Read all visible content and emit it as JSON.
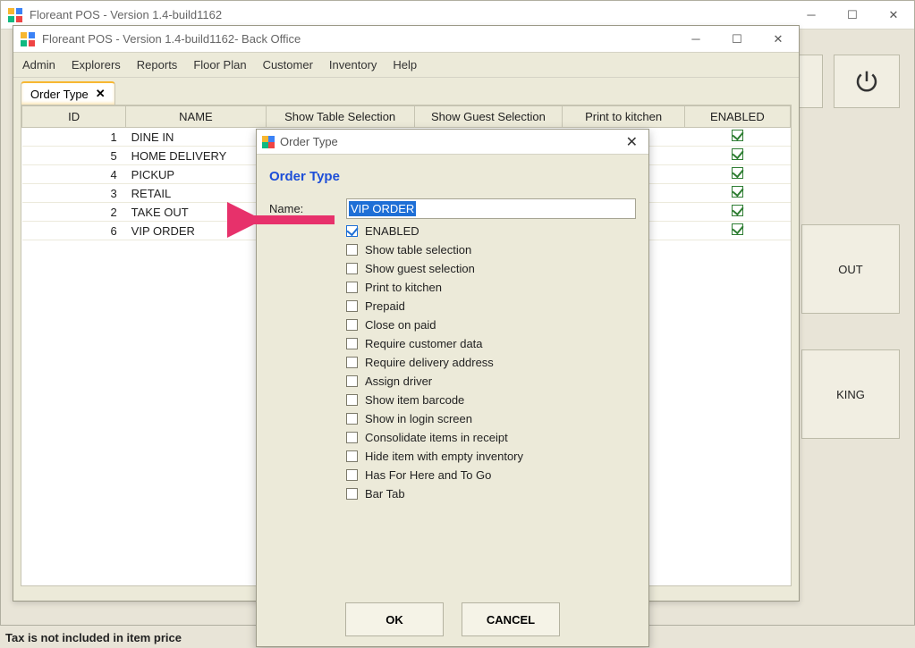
{
  "main_window": {
    "title": "Floreant POS - Version 1.4-build1162"
  },
  "back_office": {
    "title": "Floreant POS - Version 1.4-build1162- Back Office",
    "menu": [
      "Admin",
      "Explorers",
      "Reports",
      "Floor Plan",
      "Customer",
      "Inventory",
      "Help"
    ],
    "tab_label": "Order Type"
  },
  "table": {
    "headers": [
      "ID",
      "NAME",
      "Show Table Selection",
      "Show Guest Selection",
      "Print to kitchen",
      "ENABLED"
    ],
    "rows": [
      {
        "id": "1",
        "name": "DINE IN",
        "enabled": true
      },
      {
        "id": "5",
        "name": "HOME DELIVERY",
        "enabled": true
      },
      {
        "id": "4",
        "name": "PICKUP",
        "enabled": true
      },
      {
        "id": "3",
        "name": "RETAIL",
        "enabled": true
      },
      {
        "id": "2",
        "name": "TAKE OUT",
        "enabled": true
      },
      {
        "id": "6",
        "name": "VIP ORDER",
        "enabled": true
      }
    ]
  },
  "dialog": {
    "titlebar": "Order Type",
    "heading": "Order Type",
    "name_label": "Name:",
    "name_value": "VIP ORDER",
    "options": [
      {
        "label": "ENABLED",
        "checked": true
      },
      {
        "label": "Show table selection",
        "checked": false
      },
      {
        "label": "Show guest selection",
        "checked": false
      },
      {
        "label": "Print to kitchen",
        "checked": false
      },
      {
        "label": "Prepaid",
        "checked": false
      },
      {
        "label": "Close on paid",
        "checked": false
      },
      {
        "label": "Require customer data",
        "checked": false
      },
      {
        "label": "Require delivery address",
        "checked": false
      },
      {
        "label": "Assign driver",
        "checked": false
      },
      {
        "label": "Show item barcode",
        "checked": false
      },
      {
        "label": "Show in login screen",
        "checked": false
      },
      {
        "label": "Consolidate items in receipt",
        "checked": false
      },
      {
        "label": "Hide item with empty inventory",
        "checked": false
      },
      {
        "label": "Has For Here and To Go",
        "checked": false
      },
      {
        "label": "Bar Tab",
        "checked": false
      }
    ],
    "ok": "OK",
    "cancel": "CANCEL"
  },
  "side": {
    "out": "OUT",
    "king": "KING"
  },
  "statusbar": "Tax is not included in item price"
}
